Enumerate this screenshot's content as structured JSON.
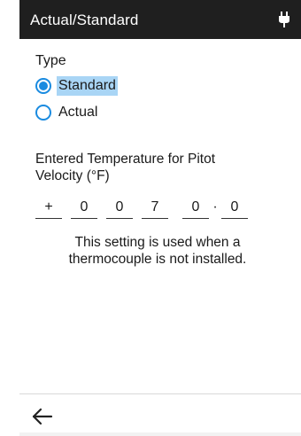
{
  "header": {
    "title": "Actual/Standard",
    "status_icon": "plug-icon"
  },
  "type_section": {
    "label": "Type",
    "options": [
      {
        "label": "Standard",
        "selected": true
      },
      {
        "label": "Actual",
        "selected": false
      }
    ]
  },
  "temperature": {
    "label": "Entered Temperature for Pitot Velocity (°F)",
    "sign": "+",
    "digits": [
      "0",
      "0",
      "7",
      "0"
    ],
    "decimal_separator": "·",
    "decimal_digit": "0"
  },
  "note": "This setting is used when a thermocouple is not installed.",
  "footer": {
    "back_icon": "arrow-left-icon"
  },
  "colors": {
    "header_bg": "#1f1f1f",
    "accent": "#1a8be0",
    "selection_highlight": "#a9d5f5"
  }
}
